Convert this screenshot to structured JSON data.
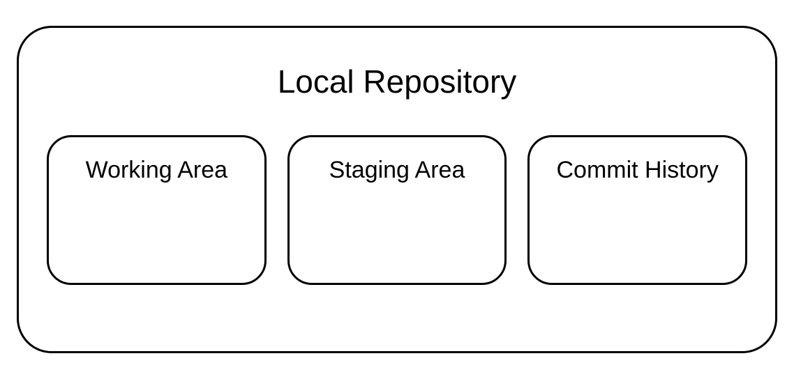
{
  "diagram": {
    "title": "Local Repository",
    "boxes": [
      {
        "label": "Working Area"
      },
      {
        "label": "Staging Area"
      },
      {
        "label": "Commit History"
      }
    ]
  }
}
